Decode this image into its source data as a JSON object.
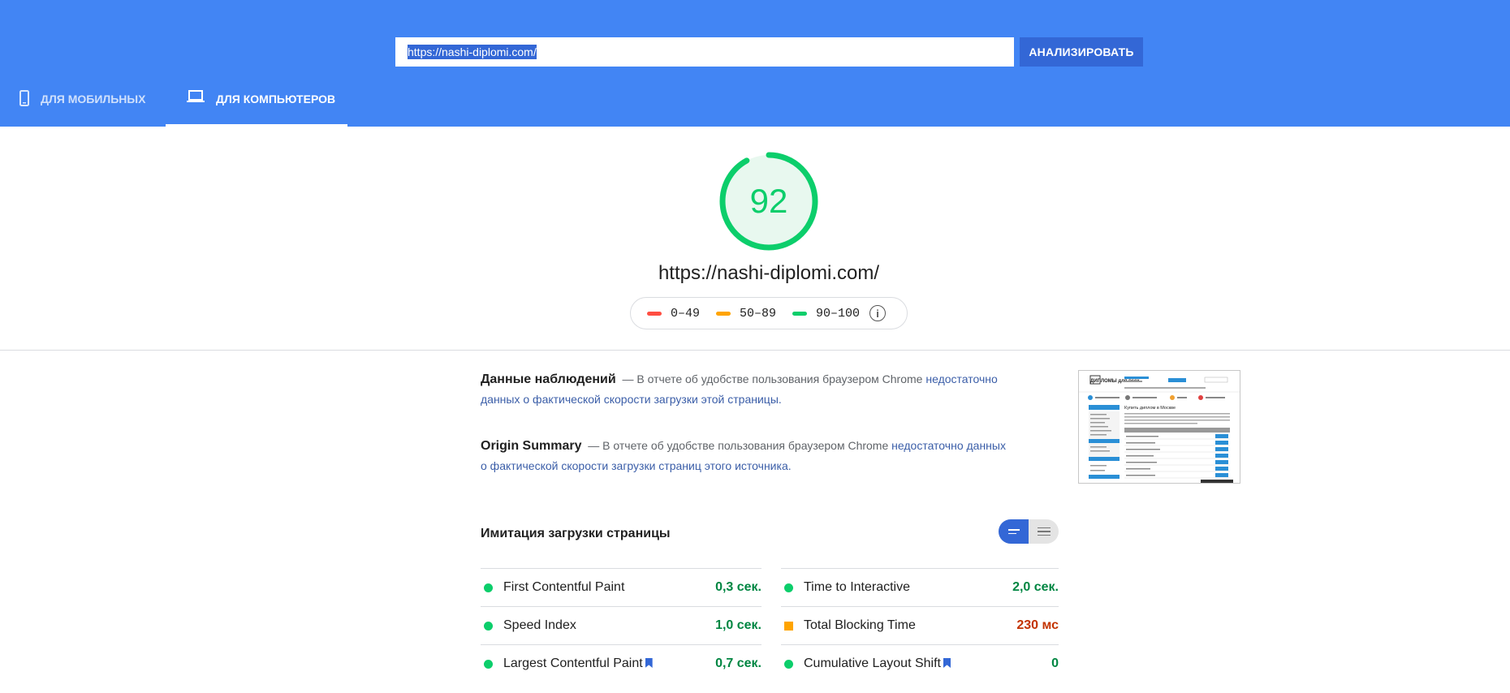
{
  "search": {
    "url_value": "https://nashi-diplomi.com/",
    "analyze_label": "АНАЛИЗИРОВАТЬ"
  },
  "tabs": [
    {
      "label": "ДЛЯ МОБИЛЬНЫХ",
      "icon": "phone-icon",
      "active": false
    },
    {
      "label": "ДЛЯ КОМПЬЮТЕРОВ",
      "icon": "laptop-icon",
      "active": true
    }
  ],
  "score": {
    "value": "92",
    "fraction": 0.92,
    "color": "#0cce6b",
    "url": "https://nashi-diplomi.com/"
  },
  "legend": [
    {
      "range": "0–49",
      "color": "#ff4e42"
    },
    {
      "range": "50–89",
      "color": "#ffa400"
    },
    {
      "range": "90–100",
      "color": "#0cce6b"
    }
  ],
  "legend_info_icon": "info-icon",
  "field_data": {
    "title": "Данные наблюдений",
    "text": "— В отчете об удобстве пользования браузером Chrome",
    "link_line1": "недостаточно",
    "link_line2": "данных о фактической скорости загрузки этой страницы."
  },
  "origin_summary": {
    "title": "Origin Summary",
    "text": "— В отчете об удобстве пользования браузером Chrome",
    "link_line1": "недостаточно данных",
    "link_line2": "о фактической скорости загрузки страниц этого источника."
  },
  "lab": {
    "title": "Имитация загрузки страницы"
  },
  "metrics": [
    {
      "name": "First Contentful Paint",
      "value": "0,3 сек.",
      "status": "pass",
      "bookmark": false
    },
    {
      "name": "Time to Interactive",
      "value": "2,0 сек.",
      "status": "pass",
      "bookmark": false
    },
    {
      "name": "Speed Index",
      "value": "1,0 сек.",
      "status": "pass",
      "bookmark": false
    },
    {
      "name": "Total Blocking Time",
      "value": "230 мс",
      "status": "average",
      "bookmark": false
    },
    {
      "name": "Largest Contentful Paint",
      "value": "0,7 сек.",
      "status": "pass",
      "bookmark": true
    },
    {
      "name": "Cumulative Layout Shift",
      "value": "0",
      "status": "pass",
      "bookmark": true
    }
  ],
  "thumbnail": {
    "logo_text": "ДИПЛОМЫ для всех",
    "heading": "Купить диплом в Москве"
  }
}
